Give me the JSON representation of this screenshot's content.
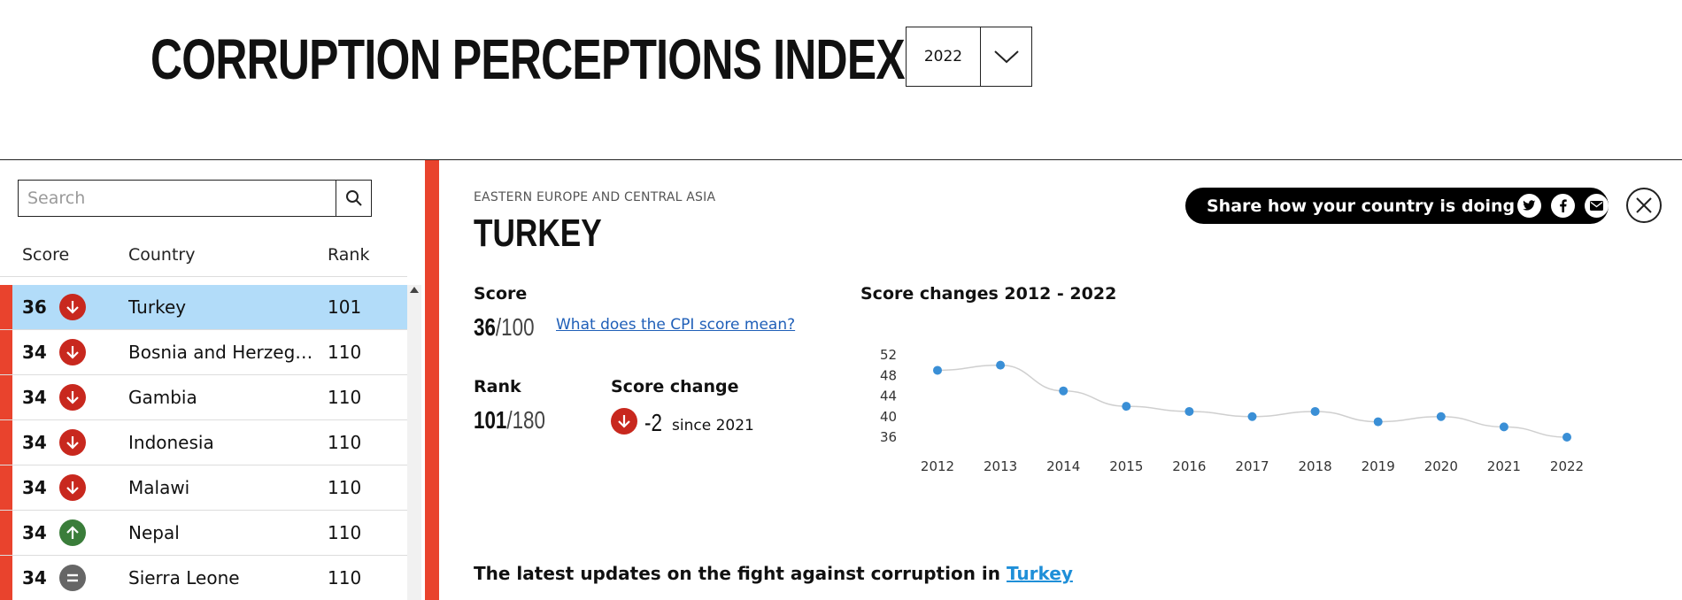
{
  "header": {
    "title": "CORRUPTION PERCEPTIONS INDEX",
    "year": "2022"
  },
  "sidebar": {
    "search_placeholder": "Search",
    "columns": {
      "score": "Score",
      "country": "Country",
      "rank": "Rank"
    },
    "rows": [
      {
        "score": "36",
        "change": "down",
        "country": "Turkey",
        "rank": "101",
        "selected": true
      },
      {
        "score": "34",
        "change": "down",
        "country": "Bosnia and Herzegov...",
        "rank": "110"
      },
      {
        "score": "34",
        "change": "down",
        "country": "Gambia",
        "rank": "110"
      },
      {
        "score": "34",
        "change": "down",
        "country": "Indonesia",
        "rank": "110"
      },
      {
        "score": "34",
        "change": "down",
        "country": "Malawi",
        "rank": "110"
      },
      {
        "score": "34",
        "change": "up",
        "country": "Nepal",
        "rank": "110"
      },
      {
        "score": "34",
        "change": "equal",
        "country": "Sierra Leone",
        "rank": "110"
      }
    ]
  },
  "colors": {
    "accent_red": "#e9432d",
    "down": "#c8281e",
    "up": "#3a7d3a",
    "equal": "#666666",
    "selected_row": "#b2dcf9",
    "chart_point": "#3a8fd6"
  },
  "panel": {
    "region": "EASTERN EUROPE AND CENTRAL ASIA",
    "country": "TURKEY",
    "share_text": "Share how your country is doing",
    "share_icons": [
      "twitter-icon",
      "facebook-icon",
      "email-icon"
    ],
    "score_label": "Score",
    "score_value": "36",
    "score_max": "/100",
    "cpi_link": "What does the CPI score mean?",
    "rank_label": "Rank",
    "rank_value": "101",
    "rank_max": "/180",
    "change_label": "Score change",
    "change_value": "-2",
    "change_since": "since 2021",
    "news_prefix": "The latest updates on the fight against corruption in",
    "news_country": "Turkey"
  },
  "chart_data": {
    "type": "line",
    "title": "Score changes 2012 - 2022",
    "categories": [
      "2012",
      "2013",
      "2014",
      "2015",
      "2016",
      "2017",
      "2018",
      "2019",
      "2020",
      "2021",
      "2022"
    ],
    "values": [
      49,
      50,
      45,
      42,
      41,
      40,
      41,
      39,
      40,
      38,
      36
    ],
    "yticks": [
      52,
      48,
      44,
      40,
      36
    ],
    "ylim": [
      36,
      52
    ],
    "grid": false
  }
}
